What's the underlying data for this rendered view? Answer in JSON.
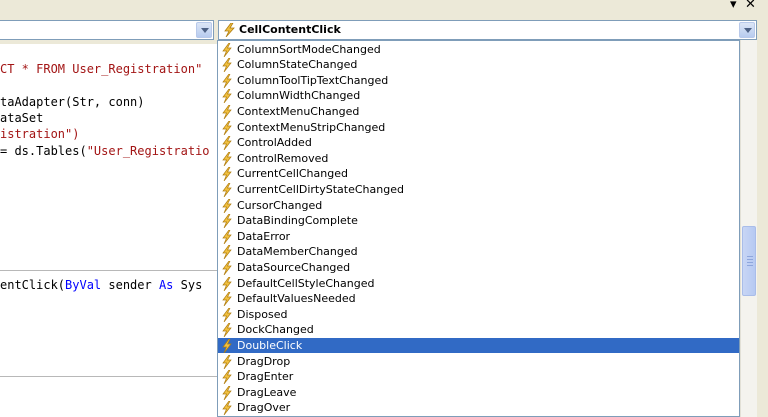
{
  "window": {
    "dropdown_glyph": "▾",
    "close_glyph": "✕"
  },
  "selector": {
    "method_value": "CellContentClick",
    "icon": "event-lightning-icon"
  },
  "code": {
    "line1": [
      "CT * FROM User_Registration\""
    ],
    "line2": "taAdapter(Str, conn)",
    "line3": "ataSet",
    "line4": "istration\")",
    "line5a": "= ds.Tables(",
    "line5b": "\"User_Registratio",
    "line6a": "entClick(",
    "line6b": "ByVal",
    "line6c": " sender ",
    "line6d": "As",
    "line6e": " Sys"
  },
  "events": [
    "ColumnSortModeChanged",
    "ColumnStateChanged",
    "ColumnToolTipTextChanged",
    "ColumnWidthChanged",
    "ContextMenuChanged",
    "ContextMenuStripChanged",
    "ControlAdded",
    "ControlRemoved",
    "CurrentCellChanged",
    "CurrentCellDirtyStateChanged",
    "CursorChanged",
    "DataBindingComplete",
    "DataError",
    "DataMemberChanged",
    "DataSourceChanged",
    "DefaultCellStyleChanged",
    "DefaultValuesNeeded",
    "Disposed",
    "DockChanged",
    "DoubleClick",
    "DragDrop",
    "DragEnter",
    "DragLeave",
    "DragOver"
  ],
  "selected_event": "DoubleClick",
  "colors": {
    "selection": "#316ac5",
    "string": "#a31515",
    "keyword": "#0000ff",
    "chrome": "#ece9d8"
  }
}
